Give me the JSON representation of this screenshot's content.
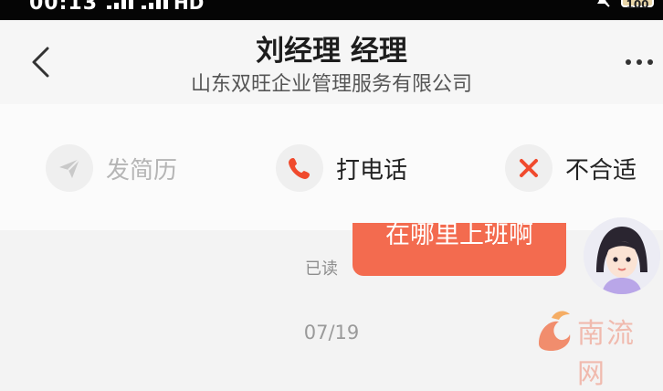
{
  "status_bar": {
    "time": "00:13",
    "network": "HD",
    "battery": "100"
  },
  "header": {
    "title": "刘经理 经理",
    "subtitle": "山东双旺企业管理服务有限公司"
  },
  "actions": [
    {
      "label": "发简历",
      "icon": "send-icon",
      "enabled": false
    },
    {
      "label": "打电话",
      "icon": "phone-icon",
      "enabled": true
    },
    {
      "label": "不合适",
      "icon": "close-icon",
      "enabled": true
    }
  ],
  "chat": {
    "message": "在哪里上班啊",
    "read_status": "已读",
    "date": "07/19"
  },
  "watermark": {
    "text": "南流网"
  },
  "colors": {
    "accent": "#f36b4f",
    "icon_red": "#f04a2d",
    "disabled": "#b5b5b5"
  }
}
